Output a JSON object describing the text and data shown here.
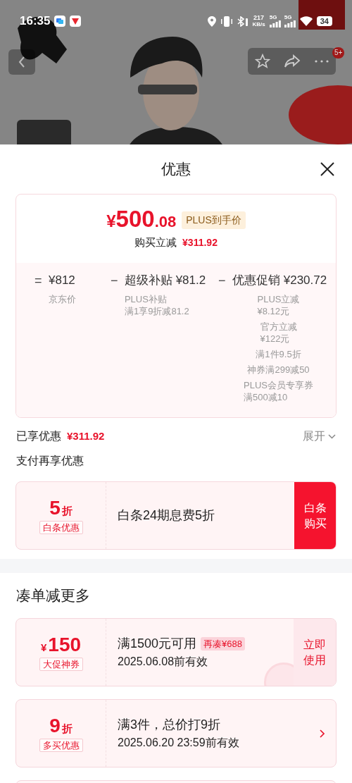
{
  "status_bar": {
    "time": "16:35",
    "speed": "217",
    "speed_unit": "KB/s",
    "networks": [
      "5G",
      "5G"
    ],
    "battery": "34"
  },
  "header": {
    "badge": "5+"
  },
  "sheet": {
    "title": "优惠",
    "price_card": {
      "currency": "¥",
      "price_int": "500",
      "price_dec": ".08",
      "tag": "PLUS到手价",
      "saving_label": "购买立减",
      "saving_value": "¥311.92",
      "terms": [
        {
          "operator": "=",
          "value": "¥812",
          "details": [
            {
              "lines": [
                "京东价"
              ]
            }
          ]
        },
        {
          "operator": "−",
          "name": "超级补贴",
          "value": "¥81.2",
          "details": [
            {
              "lines": [
                "PLUS补贴",
                "满1享9折减81.2"
              ]
            }
          ]
        },
        {
          "operator": "−",
          "name": "优惠促销",
          "value": "¥230.72",
          "details": [
            {
              "lines": [
                "PLUS立减",
                "¥8.12元"
              ]
            },
            {
              "lines": [
                "官方立减",
                "¥122元"
              ]
            },
            {
              "lines": [
                "满1件9.5折"
              ]
            },
            {
              "lines": [
                "神券满299减50"
              ]
            },
            {
              "lines": [
                "PLUS会员专享券",
                "满500减10"
              ]
            }
          ]
        }
      ]
    },
    "enjoyed": {
      "label": "已享优惠",
      "value": "¥311.92",
      "expand": "展开"
    },
    "pay_title": "支付再享优惠",
    "pay_offers": [
      {
        "amount": "5",
        "unit": "折",
        "tag": "白条优惠",
        "title": "白条24期息费5折",
        "claimed": false,
        "action": {
          "kind": "filled",
          "text": "白条购买"
        }
      }
    ],
    "more_title": "凑单减更多",
    "coupons": [
      {
        "prefix": "¥",
        "amount": "150",
        "tag": "大促神券",
        "title": "满1500元可用",
        "badge": "再凑¥688",
        "validity": "2025.06.08前有效",
        "claimed": true,
        "action": {
          "kind": "tinted",
          "text": "立即使用"
        }
      },
      {
        "amount": "9",
        "unit": "折",
        "tag": "多买优惠",
        "title": "满3件，总价打9折",
        "validity": "2025.06.20 23:59前有效",
        "claimed": false,
        "action": {
          "kind": "arrow"
        }
      }
    ]
  }
}
